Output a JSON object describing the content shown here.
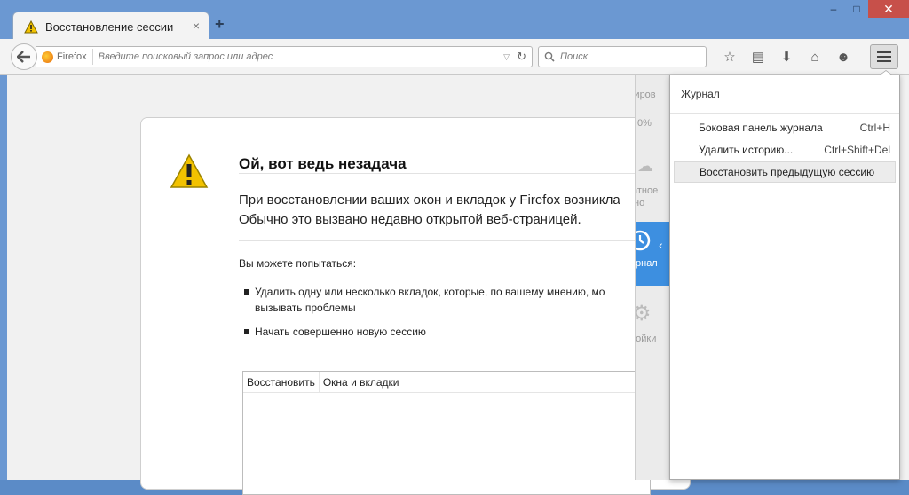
{
  "tab": {
    "title": "Восстановление сессии",
    "close": "×"
  },
  "new_tab": "+",
  "window_controls": {
    "minimize": "‒",
    "maximize": "□",
    "close": "✕"
  },
  "urlbar": {
    "identity": "Firefox",
    "placeholder": "Введите поисковый запрос или адрес"
  },
  "searchbar": {
    "placeholder": "Поиск"
  },
  "error_page": {
    "title": "Ой, вот ведь незадача",
    "line1": "При восстановлении ваших окон и вкладок у Firefox возникла",
    "line2": "Обычно это вызвано недавно открытой веб-страницей.",
    "try_label": "Вы можете попытаться:",
    "bullet1a": "Удалить одну или несколько вкладок, которые, по вашему мнению, мо",
    "bullet1b": "вызывать проблемы",
    "bullet2": "Начать совершенно новую сессию",
    "table_headers": [
      "Восстановить",
      "Окна и вкладки"
    ]
  },
  "sidebar_fragments": {
    "a": "лиров",
    "b": "0%",
    "c": "атное",
    "d": "но",
    "e": "рнал",
    "f": "ройки"
  },
  "history_panel": {
    "header": "Журнал",
    "items": [
      {
        "label": "Боковая панель журнала",
        "shortcut": "Ctrl+H"
      },
      {
        "label": "Удалить историю...",
        "shortcut": "Ctrl+Shift+Del"
      },
      {
        "label": "Восстановить предыдущую сессию",
        "shortcut": ""
      }
    ]
  },
  "colors": {
    "accent": "#3d8fe0",
    "close_button": "#c7504a",
    "warning": "#f2c200"
  }
}
